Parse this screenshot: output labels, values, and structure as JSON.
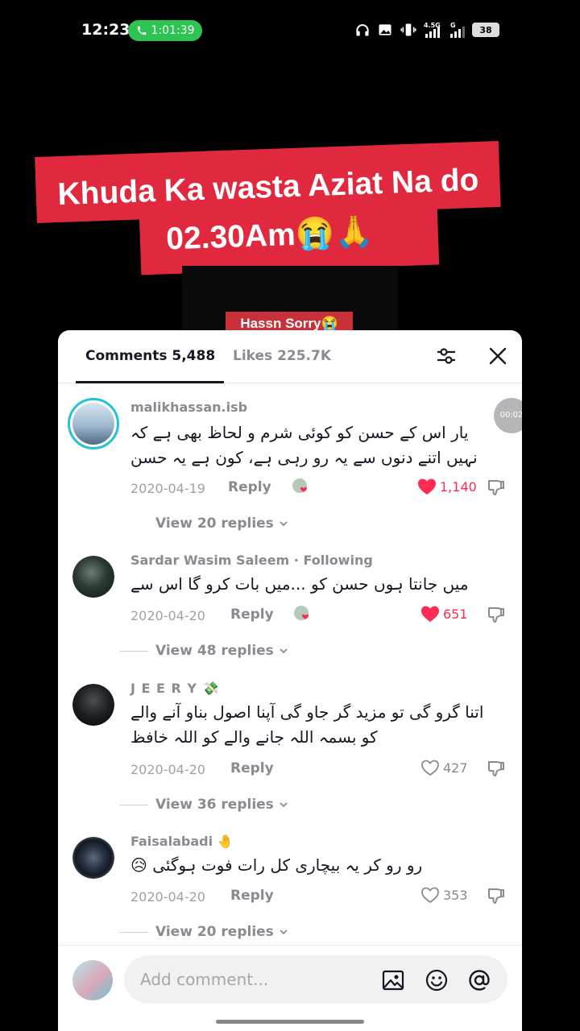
{
  "status_bar": {
    "time": "12:23",
    "call_timer": "1:01:39",
    "battery": "38",
    "network": "4.5G"
  },
  "video": {
    "caption_line1": "Khuda Ka wasta Aziat Na do",
    "caption_line2": "02.30Am😭🙏",
    "overlay_tag": "Hassn Sorry😭"
  },
  "sheet": {
    "tab_comments": "Comments 5,488",
    "tab_likes": "Likes 225.7K",
    "timer_badge": "00:02",
    "comments": [
      {
        "username": "malikhassan.isb",
        "text": "یار اس کے حسن کو کوئی شرم و لحاظ بھی ہے کہ نہیں اتنے دنوں سے یہ رو رہی ہے، کون ہے یہ حسن",
        "date": "2020-04-19",
        "reply": "Reply",
        "likes": "1,140",
        "liked": true,
        "view_replies": "View 20 replies"
      },
      {
        "username": "Sardar Wasim Saleem · Following",
        "text": "میں جانتا ہوں حسن کو ...میں بات کرو گا اس سے",
        "date": "2020-04-20",
        "reply": "Reply",
        "likes": "651",
        "liked": true,
        "view_replies": "View 48 replies"
      },
      {
        "username": "J E E R Y",
        "username_emoji": "💸",
        "text": "اتنا گرو گی تو مزید گر جاو گی آپنا اصول بناو آنے والے کو بسمہ اللہ جانے والے کو اللہ خافظ",
        "date": "2020-04-20",
        "reply": "Reply",
        "likes": "427",
        "liked": false,
        "view_replies": "View 36 replies"
      },
      {
        "username": "Faisalabadi",
        "username_emoji": "🤚",
        "text": "رو رو کر یہ بیچاری کل رات فوت ہوگئی 😥",
        "date": "2020-04-20",
        "reply": "Reply",
        "likes": "353",
        "liked": false,
        "view_replies": "View 20 replies"
      }
    ]
  },
  "footer": {
    "placeholder": "Add comment..."
  },
  "colors": {
    "accent": "#fe2c55",
    "caption_bg": "#e0283e",
    "call_green": "#2ec451"
  }
}
